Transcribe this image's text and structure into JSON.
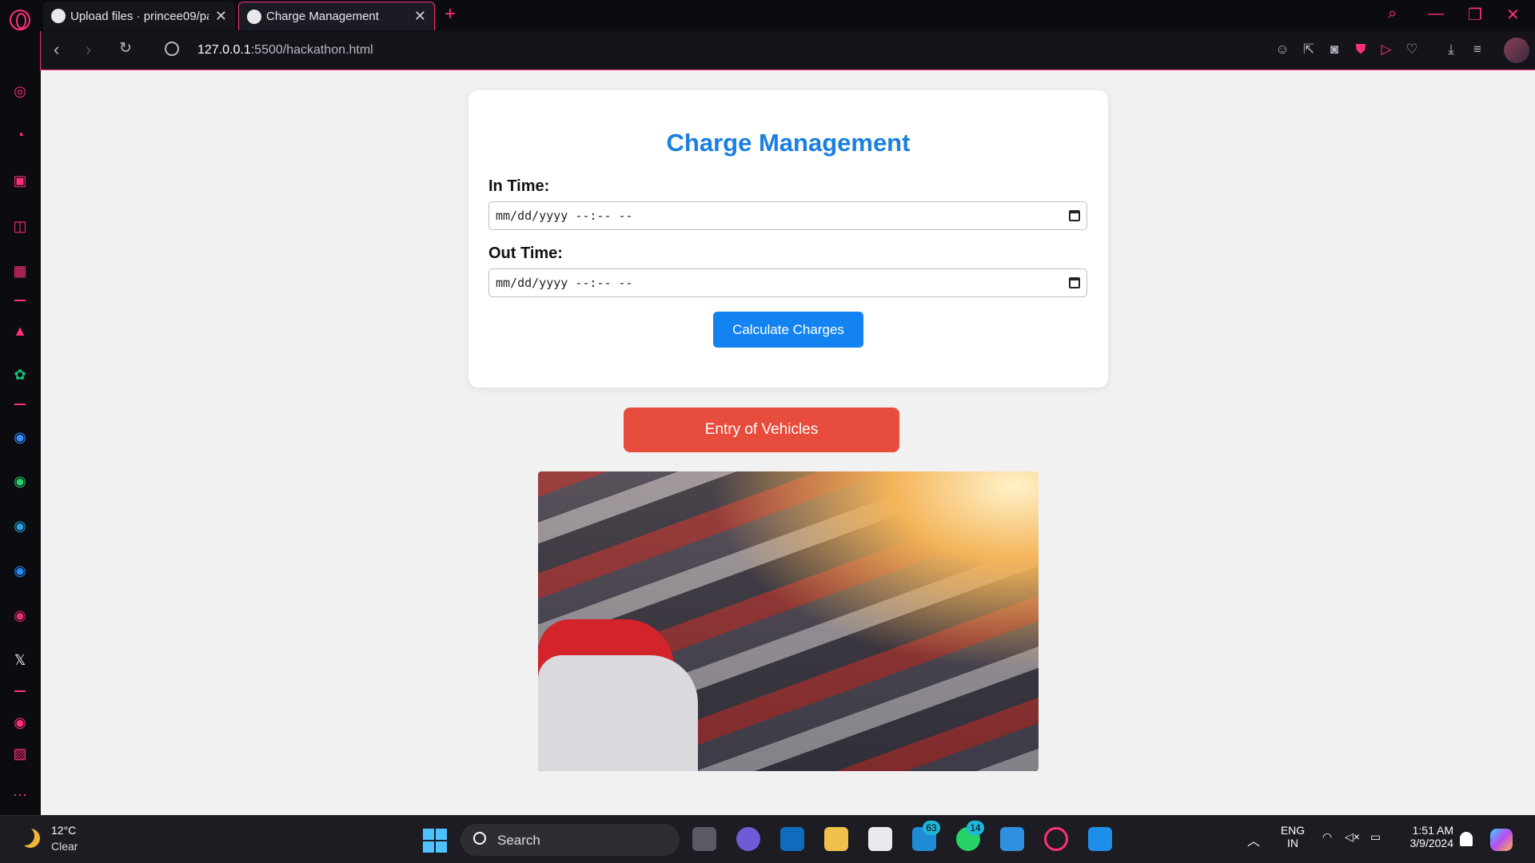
{
  "browser": {
    "tabs": [
      {
        "label": "Upload files · princee09/pa",
        "icon": "github-icon"
      },
      {
        "label": "Charge Management",
        "icon": "globe-icon"
      }
    ],
    "new_tab": "+",
    "url_host": "127.0.0.1",
    "url_path": ":5500/hackathon.html"
  },
  "page": {
    "title": "Charge Management",
    "in_time_label": "In Time:",
    "in_time_placeholder": "mm/dd/yyyy --:-- --",
    "out_time_label": "Out Time:",
    "out_time_placeholder": "mm/dd/yyyy --:-- --",
    "calculate_button": "Calculate Charges",
    "entry_button": "Entry of Vehicles",
    "colors": {
      "title": "#1a7fe0",
      "calculate": "#1383f2",
      "entry": "#e74c3c"
    }
  },
  "taskbar": {
    "weather_temp": "12°C",
    "weather_condition": "Clear",
    "search_label": "Search",
    "badges": {
      "mail": "63",
      "whatsapp": "14"
    },
    "language_line1": "ENG",
    "language_line2": "IN",
    "time": "1:51 AM",
    "date": "3/9/2024"
  }
}
